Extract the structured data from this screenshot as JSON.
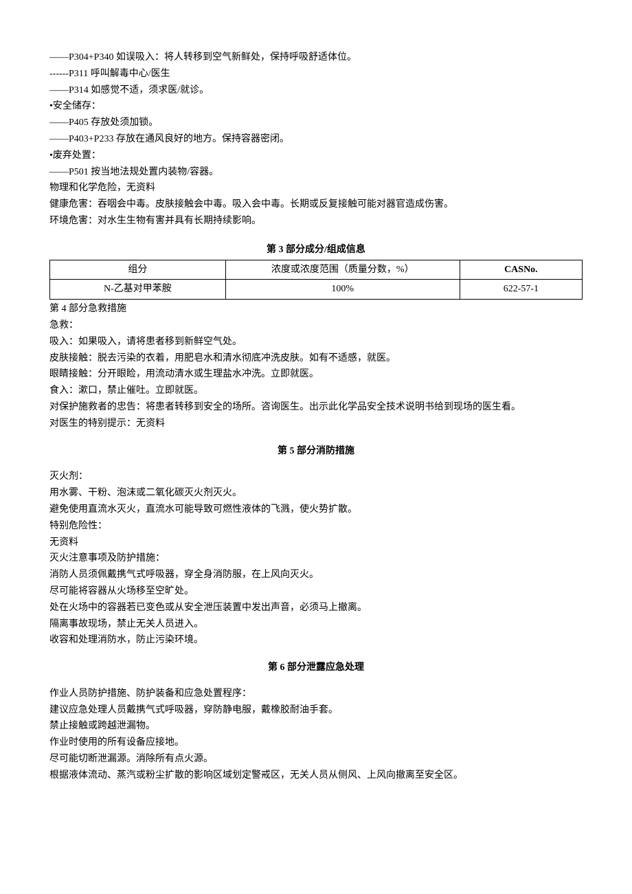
{
  "lines": {
    "l1": "——P304+P340 如误吸入：将人转移到空气新鲜处，保持呼吸舒适体位。",
    "l2": "------P311 呼叫解毒中心/医生",
    "l3": "——P314 如感觉不适，须求医/就诊。",
    "l4": "•安全储存：",
    "l5": "——P405 存放处须加锁。",
    "l6": "——P403+P233 存放在通风良好的地方。保持容器密闭。",
    "l7": "•废弃处置：",
    "l8": "——P501 按当地法规处置内装物/容器。",
    "l9": "物理和化学危险，无资料",
    "l10": "健康危害：吞咽会中毒。皮肤接触会中毒。吸入会中毒。长期或反复接触可能对器官造成伤害。",
    "l11": "环境危害：对水生生物有害并具有长期持续影响。"
  },
  "section3": {
    "title": "第 3 部分成分/组成信息",
    "headers": {
      "c1": "组分",
      "c2": "浓度或浓度范围（质量分数，%）",
      "c3": "CASNo."
    },
    "row": {
      "c1": "N-乙基对甲苯胺",
      "c2": "100%",
      "c3": "622-57-1"
    }
  },
  "section4": {
    "head": "第 4 部分急救措施",
    "p1": "急救：",
    "p2": "吸入：如果吸入，请将患者移到新鲜空气处。",
    "p3": "皮肤接触：脱去污染的衣着，用肥皂水和清水彻底冲洗皮肤。如有不适感，就医。",
    "p4": "眼睛接触：分开眼睑，用流动清水或生理盐水冲洗。立即就医。",
    "p5": "食入：漱口，禁止催吐。立即就医。",
    "p6": "对保护施救者的忠告：将患者转移到安全的场所。咨询医生。出示此化学品安全技术说明书给到现场的医生看。",
    "p7": "对医生的特别提示：无资料"
  },
  "section5": {
    "title": "第 5 部分消防措施",
    "p1": "灭火剂：",
    "p2": "用水雾、干粉、泡沫或二氧化碳灭火剂灭火。",
    "p3": "避免使用直流水灭火，直流水可能导致可燃性液体的飞溅，使火势扩散。",
    "p4": "特别危险性：",
    "p5": "无资料",
    "p6": "灭火注意事项及防护措施：",
    "p7": "消防人员须佩戴携气式呼吸器，穿全身消防服，在上风向灭火。",
    "p8": "尽可能将容器从火场移至空旷处。",
    "p9": "处在火场中的容器若已变色或从安全泄压装置中发出声音，必须马上撤离。",
    "p10": "隔离事故现场，禁止无关人员进入。",
    "p11": "收容和处理消防水，防止污染环境。"
  },
  "section6": {
    "title": "第 6 部分泄露应急处理",
    "p1": "作业人员防护措施、防护装备和应急处置程序：",
    "p2": "建议应急处理人员戴携气式呼吸器，穿防静电服，戴橡胶耐油手套。",
    "p3": "禁止接触或跨越泄漏物。",
    "p4": "作业时使用的所有设备应接地。",
    "p5": "尽可能切断泄漏源。消除所有点火源。",
    "p6": "根据液体流动、蒸汽或粉尘扩散的影响区域划定警戒区，无关人员从侧风、上风向撤离至安全区。"
  }
}
